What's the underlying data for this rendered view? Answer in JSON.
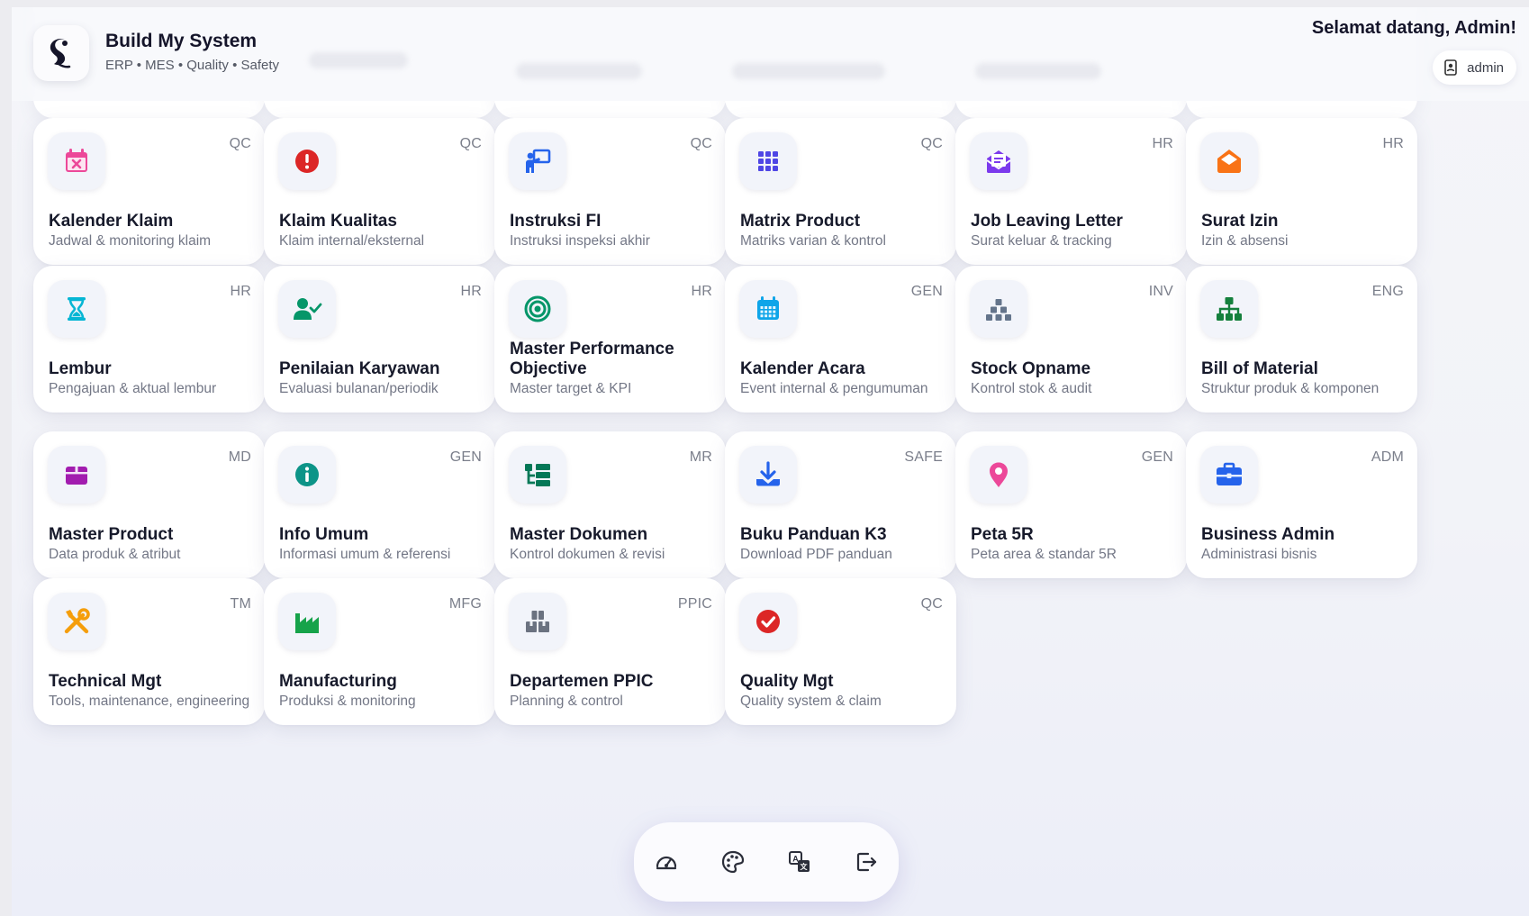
{
  "header": {
    "brand_title": "Build My System",
    "brand_subtitle": "ERP • MES • Quality • Safety",
    "welcome": "Selamat datang, Admin!",
    "user_label": "admin"
  },
  "colors": {
    "accent": "#7c3aed",
    "card_bg": "#ffffff",
    "page_bg": "#f2f3f8"
  },
  "cards": [
    {
      "title": "Kalender Klaim",
      "desc": "Jadwal & monitoring klaim",
      "tag": "QC",
      "icon": "calendar-x-icon",
      "color": "#ec4899"
    },
    {
      "title": "Klaim Kualitas",
      "desc": "Klaim internal/eksternal",
      "tag": "QC",
      "icon": "alert-circle-icon",
      "color": "#dc2626"
    },
    {
      "title": "Instruksi FI",
      "desc": "Instruksi inspeksi akhir",
      "tag": "QC",
      "icon": "chalkboard-teacher-icon",
      "color": "#2563eb"
    },
    {
      "title": "Matrix Product",
      "desc": "Matriks varian & kontrol",
      "tag": "QC",
      "icon": "grid-icon",
      "color": "#4f46e5"
    },
    {
      "title": "Job Leaving Letter",
      "desc": "Surat keluar & tracking",
      "tag": "HR",
      "icon": "envelope-open-icon",
      "color": "#7c3aed"
    },
    {
      "title": "Surat Izin",
      "desc": "Izin & absensi",
      "tag": "HR",
      "icon": "envelope-icon",
      "color": "#f97316"
    },
    {
      "title": "Lembur",
      "desc": "Pengajuan & aktual lembur",
      "tag": "HR",
      "icon": "hourglass-icon",
      "color": "#06b6d4"
    },
    {
      "title": "Penilaian Karyawan",
      "desc": "Evaluasi bulanan/periodik",
      "tag": "HR",
      "icon": "user-check-icon",
      "color": "#059669"
    },
    {
      "title": "Master Performance Objective",
      "desc": "Master target & KPI",
      "tag": "HR",
      "icon": "target-icon",
      "color": "#059669"
    },
    {
      "title": "Kalender Acara",
      "desc": "Event internal & pengumuman",
      "tag": "GEN",
      "icon": "calendar-icon",
      "color": "#0ea5e9"
    },
    {
      "title": "Stock Opname",
      "desc": "Kontrol stok & audit",
      "tag": "INV",
      "icon": "boxes-icon",
      "color": "#64748b"
    },
    {
      "title": "Bill of Material",
      "desc": "Struktur produk & komponen",
      "tag": "ENG",
      "icon": "sitemap-icon",
      "color": "#15803d"
    },
    {
      "title": "Master Product",
      "desc": "Data produk & atribut",
      "tag": "MD",
      "icon": "box-icon",
      "color": "#a21caf"
    },
    {
      "title": "Info Umum",
      "desc": "Informasi umum & referensi",
      "tag": "GEN",
      "icon": "info-icon",
      "color": "#0d9488"
    },
    {
      "title": "Master Dokumen",
      "desc": "Kontrol dokumen & revisi",
      "tag": "MR",
      "icon": "folder-tree-icon",
      "color": "#047857"
    },
    {
      "title": "Buku Panduan K3",
      "desc": "Download PDF panduan",
      "tag": "SAFE",
      "icon": "download-icon",
      "color": "#2563eb"
    },
    {
      "title": "Peta 5R",
      "desc": "Peta area & standar 5R",
      "tag": "GEN",
      "icon": "map-pin-icon",
      "color": "#ec4899"
    },
    {
      "title": "Business Admin",
      "desc": "Administrasi bisnis",
      "tag": "ADM",
      "icon": "briefcase-icon",
      "color": "#2563eb"
    },
    {
      "title": "Technical Mgt",
      "desc": "Tools, maintenance, engineering",
      "tag": "TM",
      "icon": "tools-icon",
      "color": "#f59e0b"
    },
    {
      "title": "Manufacturing",
      "desc": "Produksi & monitoring",
      "tag": "MFG",
      "icon": "industry-icon",
      "color": "#16a34a"
    },
    {
      "title": "Departemen PPIC",
      "desc": "Planning & control",
      "tag": "PPIC",
      "icon": "boxes-stacked-icon",
      "color": "#6b7280"
    },
    {
      "title": "Quality Mgt",
      "desc": "Quality system & claim",
      "tag": "QC",
      "icon": "check-circle-icon",
      "color": "#dc2626"
    }
  ],
  "dock": [
    {
      "name": "dashboard-gauge-icon"
    },
    {
      "name": "palette-icon"
    },
    {
      "name": "translate-icon"
    },
    {
      "name": "logout-icon"
    }
  ]
}
